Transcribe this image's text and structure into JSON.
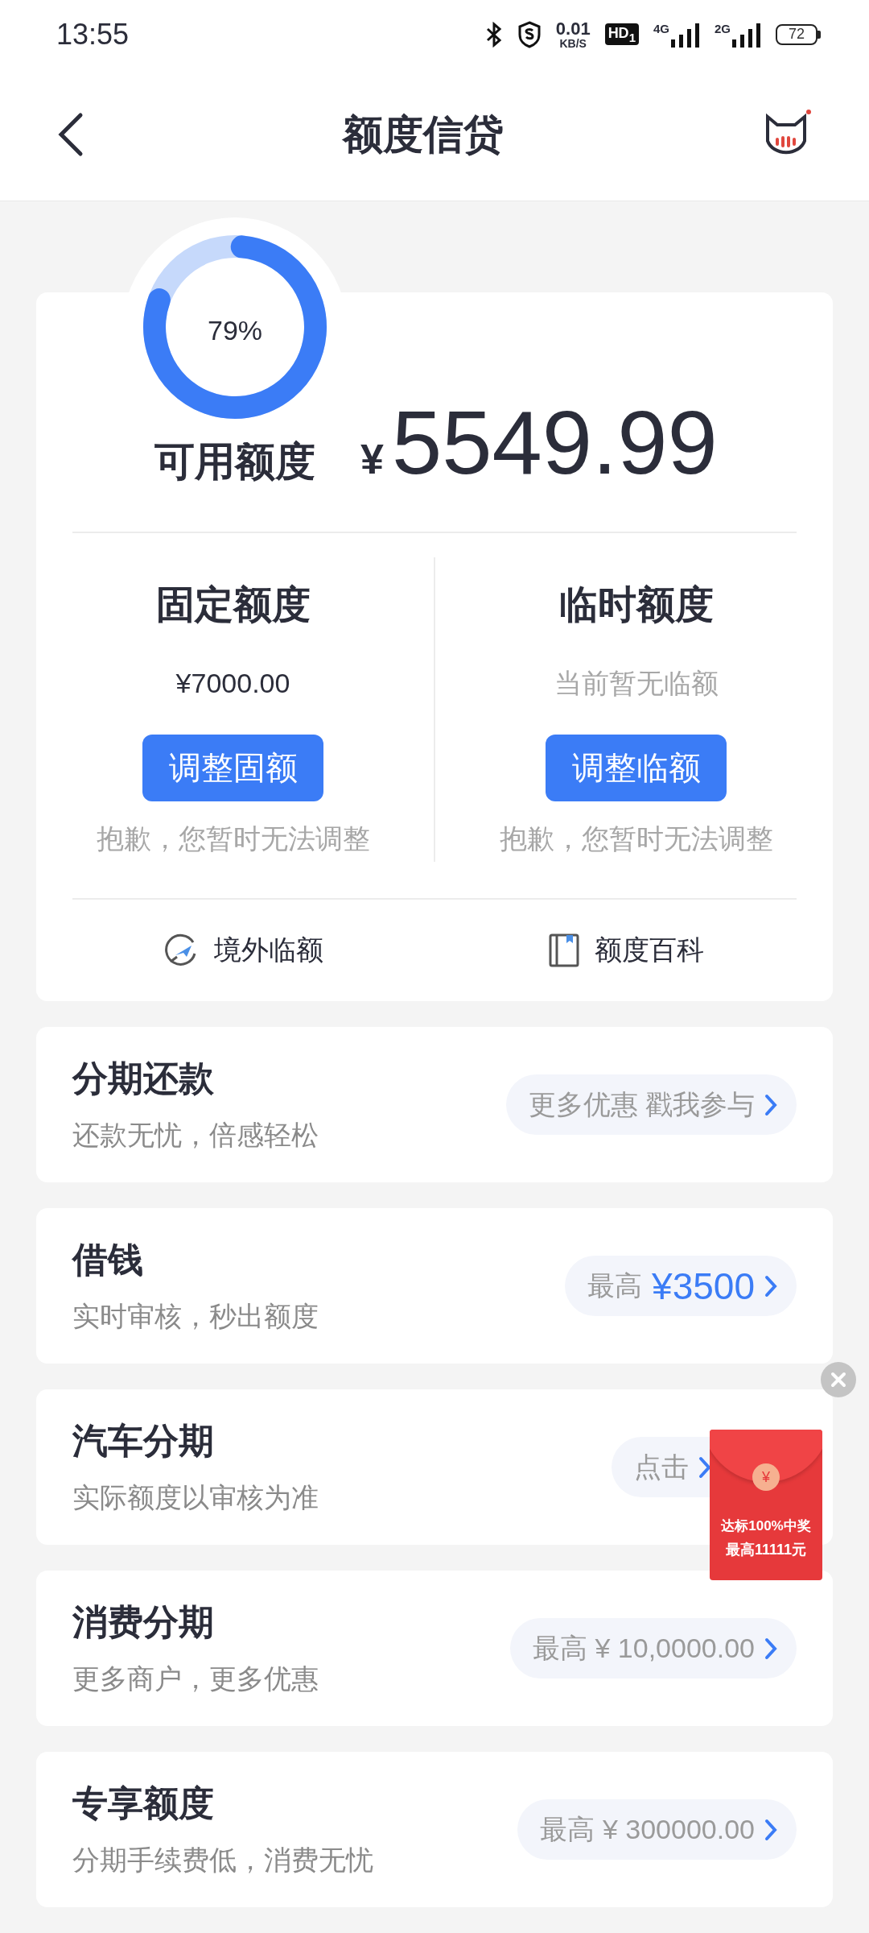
{
  "status_bar": {
    "time": "13:55",
    "net_speed": {
      "value": "0.01",
      "unit": "KB/S"
    },
    "hd": "HD$_{1}$",
    "signals": [
      {
        "label": "4G"
      },
      {
        "label": "2G"
      }
    ],
    "battery": "72"
  },
  "header": {
    "title": "额度信贷"
  },
  "credit": {
    "ring": {
      "percent": "79%"
    },
    "label": "可用额度",
    "currency": "¥",
    "amount": "5549.99",
    "columns": [
      {
        "title": "固定额度",
        "value": "¥7000.00",
        "muted": false,
        "button": "调整固额",
        "note": "抱歉，您暂时无法调整"
      },
      {
        "title": "临时额度",
        "value": "当前暂无临额",
        "muted": true,
        "button": "调整临额",
        "note": "抱歉，您暂时无法调整"
      }
    ],
    "links": [
      {
        "kind": "plane",
        "label": "境外临额"
      },
      {
        "kind": "book",
        "label": "额度百科"
      }
    ]
  },
  "products": [
    {
      "title": "分期还款",
      "subtitle": "还款无忧，倍感轻松",
      "action": {
        "kind": "text",
        "label": "更多优惠 戳我参与"
      }
    },
    {
      "title": "借钱",
      "subtitle": "实时审核，秒出额度",
      "action": {
        "kind": "highlight",
        "prefix": "最高",
        "amount": "¥3500"
      }
    },
    {
      "title": "汽车分期",
      "subtitle": "实际额度以审核为准",
      "action": {
        "kind": "text",
        "label": "点击"
      }
    },
    {
      "title": "消费分期",
      "subtitle": "更多商户，更多优惠",
      "action": {
        "kind": "text",
        "label": "最高 ¥ 10,0000.00"
      }
    },
    {
      "title": "专享额度",
      "subtitle": "分期手续费低，消费无忧",
      "action": {
        "kind": "text",
        "label": "最高 ¥ 300000.00"
      }
    }
  ],
  "promo": {
    "coin": "¥",
    "lines": [
      "达标100%中奖",
      "最高11111元"
    ]
  }
}
